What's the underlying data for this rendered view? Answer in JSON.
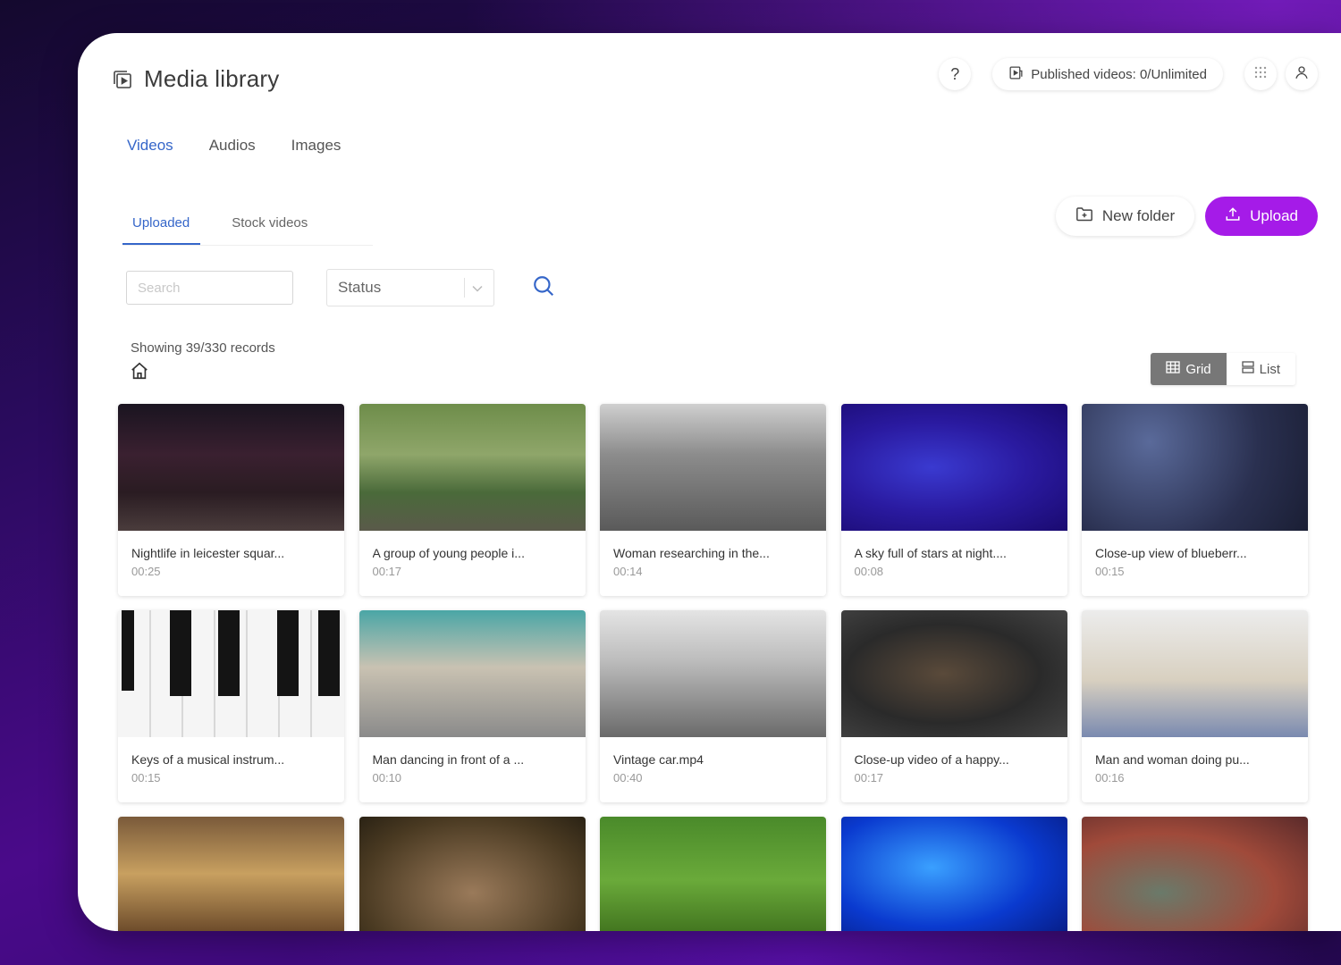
{
  "header": {
    "title": "Media library",
    "help_label": "?",
    "published_label": "Published videos: 0/Unlimited"
  },
  "main_tabs": [
    {
      "label": "Videos",
      "active": true
    },
    {
      "label": "Audios",
      "active": false
    },
    {
      "label": "Images",
      "active": false
    }
  ],
  "sub_tabs": [
    {
      "label": "Uploaded",
      "active": true
    },
    {
      "label": "Stock videos",
      "active": false
    }
  ],
  "actions": {
    "new_folder_label": "New folder",
    "upload_label": "Upload"
  },
  "filters": {
    "search_placeholder": "Search",
    "status_label": "Status"
  },
  "records_text": "Showing 39/330 records",
  "view_toggle": {
    "grid_label": "Grid",
    "list_label": "List",
    "selected": "Grid"
  },
  "videos": [
    {
      "title": "Nightlife in leicester squar...",
      "duration": "00:25"
    },
    {
      "title": "A group of young people i...",
      "duration": "00:17"
    },
    {
      "title": "Woman researching in the...",
      "duration": "00:14"
    },
    {
      "title": "A sky full of stars at night....",
      "duration": "00:08"
    },
    {
      "title": "Close-up view of blueberr...",
      "duration": "00:15"
    },
    {
      "title": "Keys of a musical instrum...",
      "duration": "00:15"
    },
    {
      "title": "Man dancing in front of a ...",
      "duration": "00:10"
    },
    {
      "title": "Vintage car.mp4",
      "duration": "00:40"
    },
    {
      "title": "Close-up video of a happy...",
      "duration": "00:17"
    },
    {
      "title": "Man and woman doing pu...",
      "duration": "00:16"
    },
    {
      "title": "",
      "duration": ""
    },
    {
      "title": "",
      "duration": ""
    },
    {
      "title": "",
      "duration": ""
    },
    {
      "title": "",
      "duration": ""
    },
    {
      "title": "",
      "duration": ""
    }
  ],
  "colors": {
    "accent": "#a51be8",
    "tab_active": "#3566c9"
  }
}
